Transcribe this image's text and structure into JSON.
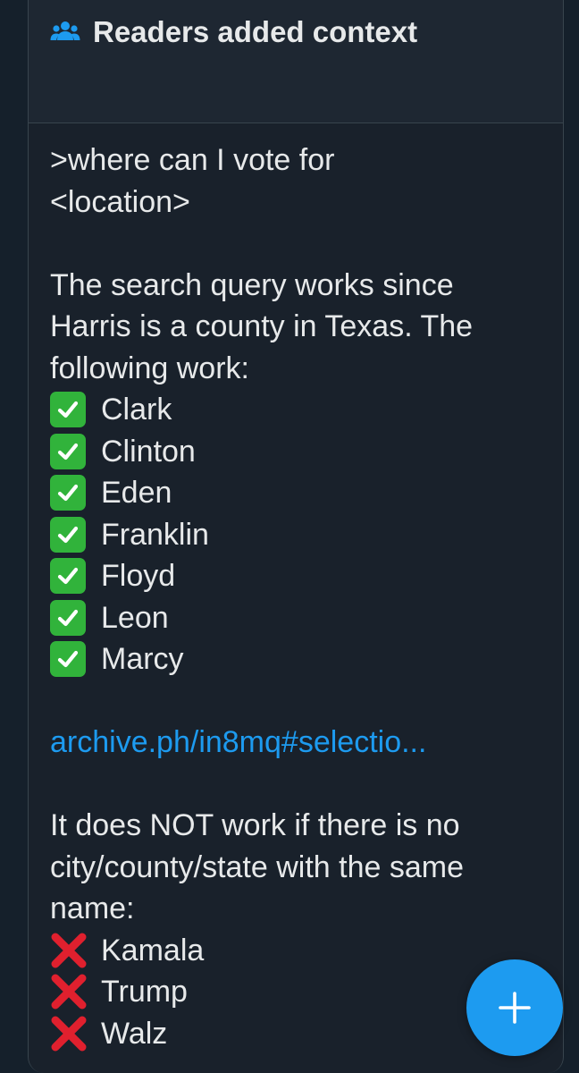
{
  "card": {
    "header": {
      "title": "Readers added context",
      "icon": "people-icon"
    },
    "intro_lines": [
      ">where can I vote for",
      "<location>"
    ],
    "explanation_lines": [
      "The search query works since",
      "Harris is a county in Texas. The",
      "following work:"
    ],
    "working_names": [
      "Clark",
      "Clinton",
      "Eden",
      "Franklin",
      "Floyd",
      "Leon",
      "Marcy"
    ],
    "link_text": "archive.ph/in8mq#selectio...",
    "not_working_lines": [
      "It does NOT work if there is no",
      "city/county/state with the same",
      "name:"
    ],
    "failing_names": [
      "Kamala",
      "Trump",
      "Walz"
    ]
  },
  "fab": {
    "icon": "plus-icon"
  },
  "colors": {
    "background": "#15202b",
    "card": "#19212b",
    "header": "#1e2732",
    "text": "#e7e9ea",
    "link": "#1d9bf0",
    "accent": "#1d9bf0",
    "check": "#31b33b",
    "cross": "#e0202e"
  }
}
